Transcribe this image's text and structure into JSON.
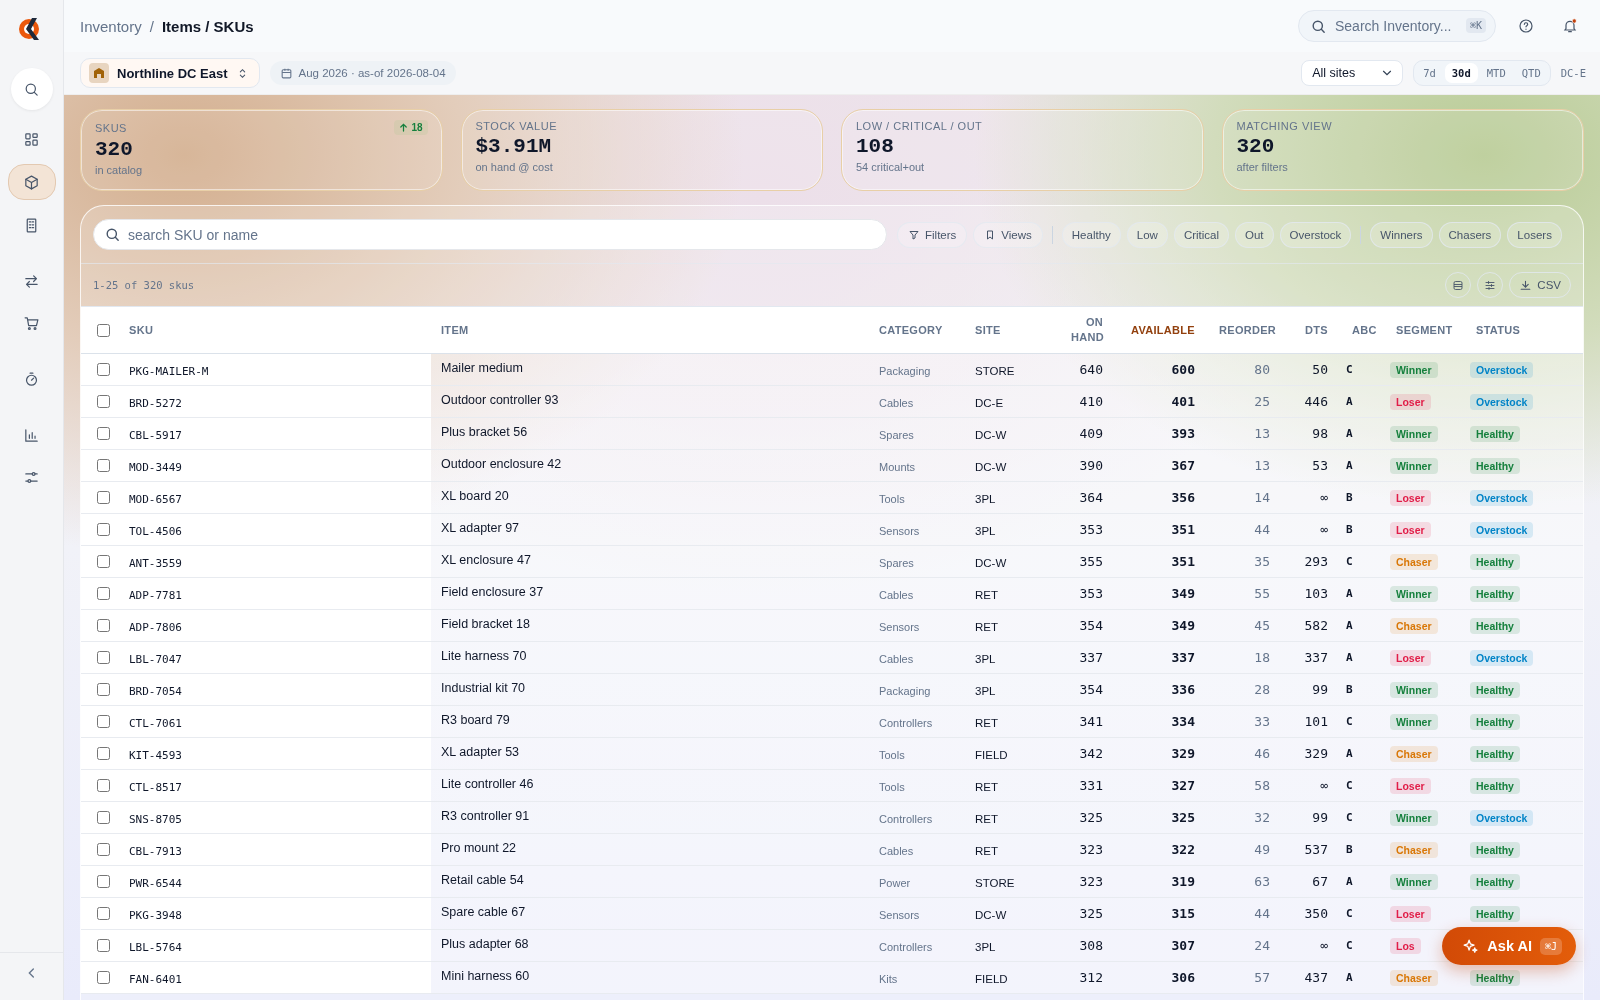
{
  "sidebar": {
    "items": [
      {
        "kind": "search",
        "selected": false
      },
      {
        "kind": "grid",
        "selected": false
      },
      {
        "kind": "box",
        "selected": true
      },
      {
        "kind": "building",
        "selected": false
      },
      {
        "kind": "transfer",
        "selected": false
      },
      {
        "kind": "cart",
        "selected": false
      },
      {
        "kind": "timer",
        "selected": false
      },
      {
        "kind": "chart",
        "selected": false
      },
      {
        "kind": "sliders",
        "selected": false
      }
    ]
  },
  "breadcrumb": {
    "parent": "Inventory",
    "separator": "/",
    "current": "Items / SKUs"
  },
  "search": {
    "placeholder": "Search Inventory...",
    "shortcut": "⌘K"
  },
  "notifications": {
    "unread": true
  },
  "location": {
    "name": "Northline DC East"
  },
  "period_label": "Aug 2026 · as-of 2026-08-04",
  "site_select": {
    "value": "All sites"
  },
  "ranges": [
    {
      "label": "7d",
      "selected": false
    },
    {
      "label": "30d",
      "selected": true
    },
    {
      "label": "MTD",
      "selected": false
    },
    {
      "label": "QTD",
      "selected": false
    }
  ],
  "site_code": "DC-E",
  "kpis": [
    {
      "label": "SKUS",
      "value": "320",
      "sub": "in catalog",
      "delta": "18"
    },
    {
      "label": "STOCK VALUE",
      "value": "$3.91M",
      "sub": "on hand @ cost"
    },
    {
      "label": "LOW / CRITICAL / OUT",
      "value": "108",
      "sub": "54 critical+out"
    },
    {
      "label": "MATCHING VIEW",
      "value": "320",
      "sub": "after filters"
    }
  ],
  "table_search": {
    "placeholder": "search SKU or name"
  },
  "tools": [
    {
      "kind": "filter",
      "label": "Filters"
    },
    {
      "kind": "bookmark",
      "label": "Views"
    }
  ],
  "status_filters": [
    "Healthy",
    "Low",
    "Critical",
    "Out",
    "Overstock"
  ],
  "segment_filters": [
    "Winners",
    "Chasers",
    "Losers"
  ],
  "range_text": "1-25 of 320 skus",
  "export_label": "CSV",
  "table": {
    "all_checked": false,
    "columns": [
      {
        "label": "SKU",
        "sorted": false
      },
      {
        "label": "ITEM",
        "sorted": false
      },
      {
        "label": "CATEGORY",
        "sorted": false
      },
      {
        "label": "SITE",
        "sorted": false
      },
      {
        "label": "ON HAND",
        "sorted": false
      },
      {
        "label": "AVAILABLE",
        "sorted": true
      },
      {
        "label": "REORDER",
        "sorted": false
      },
      {
        "label": "DTS",
        "sorted": false
      },
      {
        "label": "ABC",
        "sorted": false
      },
      {
        "label": "SEGMENT",
        "sorted": false
      },
      {
        "label": "STATUS",
        "sorted": false
      }
    ],
    "rows": [
      {
        "checked": false,
        "sku": "PKG-MAILER-M",
        "item": "Mailer medium",
        "category": "Packaging",
        "site": "STORE",
        "on_hand": "640",
        "available": "600",
        "reorder": "80",
        "dts": "50",
        "abc": "C",
        "segment": {
          "text": "Winner",
          "color": "#15803d"
        },
        "status": {
          "text": "Overstock",
          "color": "#0284c7"
        }
      },
      {
        "checked": false,
        "sku": "BRD-5272",
        "item": "Outdoor controller 93",
        "category": "Cables",
        "site": "DC-E",
        "on_hand": "410",
        "available": "401",
        "reorder": "25",
        "dts": "446",
        "abc": "A",
        "segment": {
          "text": "Loser",
          "color": "#e11d48"
        },
        "status": {
          "text": "Overstock",
          "color": "#0284c7"
        }
      },
      {
        "checked": false,
        "sku": "CBL-5917",
        "item": "Plus bracket 56",
        "category": "Spares",
        "site": "DC-W",
        "on_hand": "409",
        "available": "393",
        "reorder": "13",
        "dts": "98",
        "abc": "A",
        "segment": {
          "text": "Winner",
          "color": "#15803d"
        },
        "status": {
          "text": "Healthy",
          "color": "#15803d"
        }
      },
      {
        "checked": false,
        "sku": "MOD-3449",
        "item": "Outdoor enclosure 42",
        "category": "Mounts",
        "site": "DC-W",
        "on_hand": "390",
        "available": "367",
        "reorder": "13",
        "dts": "53",
        "abc": "A",
        "segment": {
          "text": "Winner",
          "color": "#15803d"
        },
        "status": {
          "text": "Healthy",
          "color": "#15803d"
        }
      },
      {
        "checked": false,
        "sku": "MOD-6567",
        "item": "XL board 20",
        "category": "Tools",
        "site": "3PL",
        "on_hand": "364",
        "available": "356",
        "reorder": "14",
        "dts": "∞",
        "abc": "B",
        "segment": {
          "text": "Loser",
          "color": "#e11d48"
        },
        "status": {
          "text": "Overstock",
          "color": "#0284c7"
        }
      },
      {
        "checked": false,
        "sku": "TOL-4506",
        "item": "XL adapter 97",
        "category": "Sensors",
        "site": "3PL",
        "on_hand": "353",
        "available": "351",
        "reorder": "44",
        "dts": "∞",
        "abc": "B",
        "segment": {
          "text": "Loser",
          "color": "#e11d48"
        },
        "status": {
          "text": "Overstock",
          "color": "#0284c7"
        }
      },
      {
        "checked": false,
        "sku": "ANT-3559",
        "item": "XL enclosure 47",
        "category": "Spares",
        "site": "DC-W",
        "on_hand": "355",
        "available": "351",
        "reorder": "35",
        "dts": "293",
        "abc": "C",
        "segment": {
          "text": "Chaser",
          "color": "#d97706"
        },
        "status": {
          "text": "Healthy",
          "color": "#15803d"
        }
      },
      {
        "checked": false,
        "sku": "ADP-7781",
        "item": "Field enclosure 37",
        "category": "Cables",
        "site": "RET",
        "on_hand": "353",
        "available": "349",
        "reorder": "55",
        "dts": "103",
        "abc": "A",
        "segment": {
          "text": "Winner",
          "color": "#15803d"
        },
        "status": {
          "text": "Healthy",
          "color": "#15803d"
        }
      },
      {
        "checked": false,
        "sku": "ADP-7806",
        "item": "Field bracket 18",
        "category": "Sensors",
        "site": "RET",
        "on_hand": "354",
        "available": "349",
        "reorder": "45",
        "dts": "582",
        "abc": "A",
        "segment": {
          "text": "Chaser",
          "color": "#d97706"
        },
        "status": {
          "text": "Healthy",
          "color": "#15803d"
        }
      },
      {
        "checked": false,
        "sku": "LBL-7047",
        "item": "Lite harness 70",
        "category": "Cables",
        "site": "3PL",
        "on_hand": "337",
        "available": "337",
        "reorder": "18",
        "dts": "337",
        "abc": "A",
        "segment": {
          "text": "Loser",
          "color": "#e11d48"
        },
        "status": {
          "text": "Overstock",
          "color": "#0284c7"
        }
      },
      {
        "checked": false,
        "sku": "BRD-7054",
        "item": "Industrial kit 70",
        "category": "Packaging",
        "site": "3PL",
        "on_hand": "354",
        "available": "336",
        "reorder": "28",
        "dts": "99",
        "abc": "B",
        "segment": {
          "text": "Winner",
          "color": "#15803d"
        },
        "status": {
          "text": "Healthy",
          "color": "#15803d"
        }
      },
      {
        "checked": false,
        "sku": "CTL-7061",
        "item": "R3 board 79",
        "category": "Controllers",
        "site": "RET",
        "on_hand": "341",
        "available": "334",
        "reorder": "33",
        "dts": "101",
        "abc": "C",
        "segment": {
          "text": "Winner",
          "color": "#15803d"
        },
        "status": {
          "text": "Healthy",
          "color": "#15803d"
        }
      },
      {
        "checked": false,
        "sku": "KIT-4593",
        "item": "XL adapter 53",
        "category": "Tools",
        "site": "FIELD",
        "on_hand": "342",
        "available": "329",
        "reorder": "46",
        "dts": "329",
        "abc": "A",
        "segment": {
          "text": "Chaser",
          "color": "#d97706"
        },
        "status": {
          "text": "Healthy",
          "color": "#15803d"
        }
      },
      {
        "checked": false,
        "sku": "CTL-8517",
        "item": "Lite controller 46",
        "category": "Tools",
        "site": "RET",
        "on_hand": "331",
        "available": "327",
        "reorder": "58",
        "dts": "∞",
        "abc": "C",
        "segment": {
          "text": "Loser",
          "color": "#e11d48"
        },
        "status": {
          "text": "Healthy",
          "color": "#15803d"
        }
      },
      {
        "checked": false,
        "sku": "SNS-8705",
        "item": "R3 controller 91",
        "category": "Controllers",
        "site": "RET",
        "on_hand": "325",
        "available": "325",
        "reorder": "32",
        "dts": "99",
        "abc": "C",
        "segment": {
          "text": "Winner",
          "color": "#15803d"
        },
        "status": {
          "text": "Overstock",
          "color": "#0284c7"
        }
      },
      {
        "checked": false,
        "sku": "CBL-7913",
        "item": "Pro mount 22",
        "category": "Cables",
        "site": "RET",
        "on_hand": "323",
        "available": "322",
        "reorder": "49",
        "dts": "537",
        "abc": "B",
        "segment": {
          "text": "Chaser",
          "color": "#d97706"
        },
        "status": {
          "text": "Healthy",
          "color": "#15803d"
        }
      },
      {
        "checked": false,
        "sku": "PWR-6544",
        "item": "Retail cable 54",
        "category": "Power",
        "site": "STORE",
        "on_hand": "323",
        "available": "319",
        "reorder": "63",
        "dts": "67",
        "abc": "A",
        "segment": {
          "text": "Winner",
          "color": "#15803d"
        },
        "status": {
          "text": "Healthy",
          "color": "#15803d"
        }
      },
      {
        "checked": false,
        "sku": "PKG-3948",
        "item": "Spare cable 67",
        "category": "Sensors",
        "site": "DC-W",
        "on_hand": "325",
        "available": "315",
        "reorder": "44",
        "dts": "350",
        "abc": "C",
        "segment": {
          "text": "Loser",
          "color": "#e11d48"
        },
        "status": {
          "text": "Healthy",
          "color": "#15803d"
        }
      },
      {
        "checked": false,
        "sku": "LBL-5764",
        "item": "Plus adapter 68",
        "category": "Controllers",
        "site": "3PL",
        "on_hand": "308",
        "available": "307",
        "reorder": "24",
        "dts": "∞",
        "abc": "C",
        "segment": {
          "text": "Los",
          "color": "#e11d48"
        }
      },
      {
        "checked": false,
        "sku": "FAN-6401",
        "item": "Mini harness 60",
        "category": "Kits",
        "site": "FIELD",
        "on_hand": "312",
        "available": "306",
        "reorder": "57",
        "dts": "437",
        "abc": "A",
        "segment": {
          "text": "Chaser",
          "color": "#d97706"
        },
        "status": {
          "text": "Healthy",
          "color": "#15803d"
        }
      }
    ]
  },
  "assistant": {
    "label": "Ask AI",
    "shortcut": "⌘J"
  }
}
